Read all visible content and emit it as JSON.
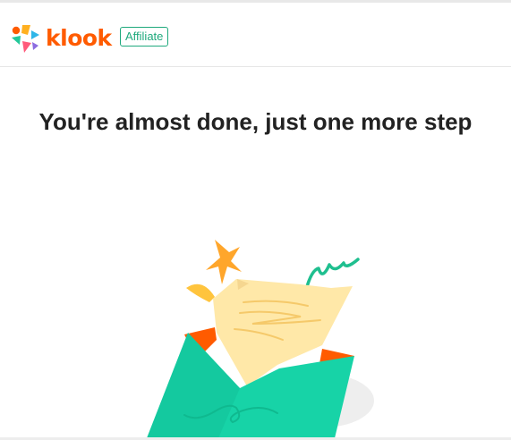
{
  "brand": {
    "wordmark": "klook",
    "badge": "Affiliate",
    "colors": {
      "brand_orange": "#ff5b00",
      "affiliate_green": "#1ea97c"
    }
  },
  "main": {
    "title": "You're almost done, just one more step"
  },
  "illustration": {
    "icon": "envelope-letter-icon",
    "colors": {
      "envelope": "#17d3a7",
      "envelope_inner": "#ff5b00",
      "letter": "#ffe8a8",
      "sparkle": "#ffa62b",
      "squiggle": "#1fbf8f"
    }
  }
}
